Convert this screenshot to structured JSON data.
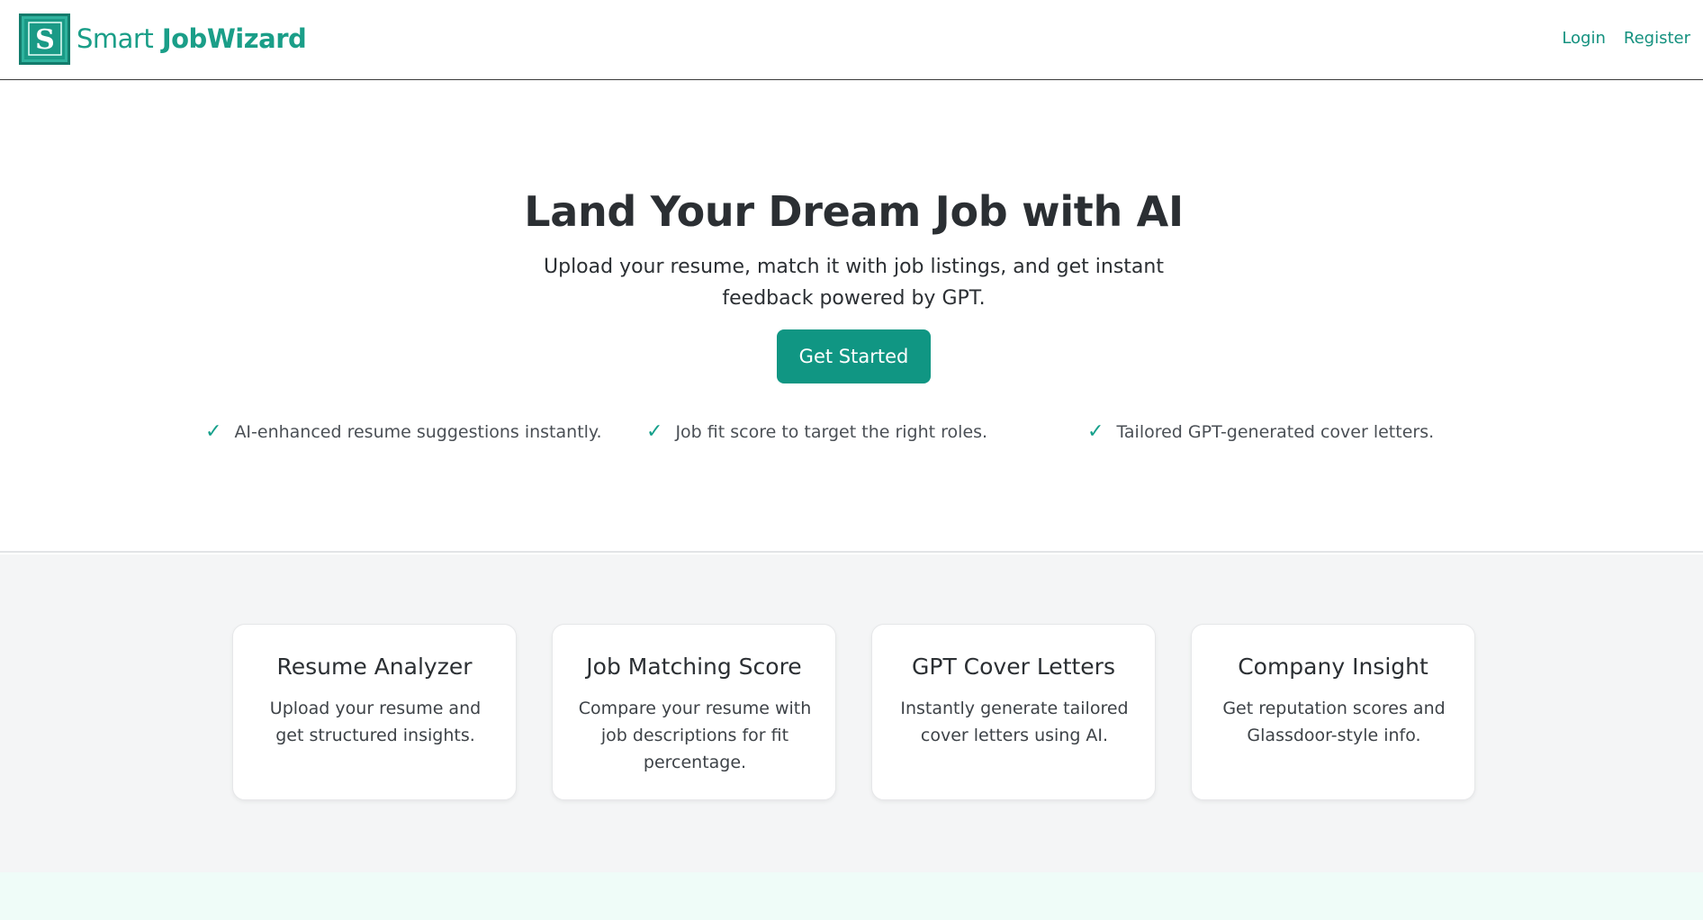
{
  "brand": {
    "logo_letter": "S",
    "name_part1": "Smart",
    "name_part2": "JobWizard"
  },
  "nav": {
    "login": "Login",
    "register": "Register"
  },
  "hero": {
    "title": "Land Your Dream Job with AI",
    "subtitle": "Upload your resume, match it with job listings, and get instant feedback powered by GPT.",
    "cta": "Get Started",
    "check_glyph": "✓",
    "bullets": [
      "AI-enhanced resume suggestions instantly.",
      "Job fit score to target the right roles.",
      "Tailored GPT-generated cover letters."
    ]
  },
  "features": [
    {
      "title": "Resume Analyzer",
      "description": "Upload your resume and get structured insights."
    },
    {
      "title": "Job Matching Score",
      "description": "Compare your resume with job descriptions for fit percentage."
    },
    {
      "title": "GPT Cover Letters",
      "description": "Instantly generate tailored cover letters using AI."
    },
    {
      "title": "Company Insight",
      "description": "Get reputation scores and Glassdoor-style info."
    }
  ],
  "colors": {
    "brand": "#1a9e88",
    "button": "#109683",
    "link": "#14917f",
    "features_bg": "#f4f5f6",
    "bottom_strip_bg": "#effcf8"
  }
}
